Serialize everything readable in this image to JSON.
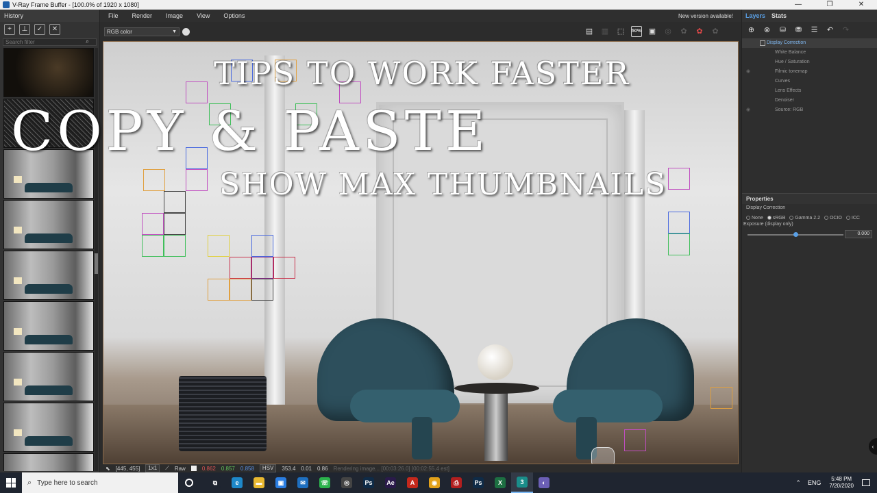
{
  "window": {
    "title": "V-Ray Frame Buffer - [100.0% of 1920 x 1080]",
    "min": "—",
    "max": "❐",
    "close": "✕"
  },
  "history": {
    "title": "History",
    "search_placeholder": "Search filter",
    "thumbs": [
      "dark",
      "noise",
      "room",
      "room",
      "room",
      "room",
      "room",
      "room",
      "room"
    ]
  },
  "menu": {
    "items": [
      "File",
      "Render",
      "Image",
      "View",
      "Options"
    ],
    "notice": "New version available!"
  },
  "toolbar": {
    "channel": "RGB color",
    "zoom_badge": "50%"
  },
  "overlay": {
    "line1": "TIPS TO WORK FASTER",
    "line2": "COPY & PASTE",
    "line3": "SHOW MAX THUMBNAILS"
  },
  "status": {
    "coords": "[445, 455]",
    "ratio": "1x1",
    "raw_label": "Raw",
    "r": "0.862",
    "g": "0.857",
    "b": "0.858",
    "mode": "HSV",
    "h": "353.4",
    "s": "0.01",
    "v": "0.86",
    "progress": "Rendering image... [00:03:26.0] [00:02:55.4 est]"
  },
  "right": {
    "tab_layers": "Layers",
    "tab_stats": "Stats",
    "layers": [
      "Display Correction",
      "White Balance",
      "Hue / Saturation",
      "Filmic tonemap",
      "Curves",
      "Lens Effects",
      "Denoiser",
      "Source: RGB"
    ],
    "properties_title": "Properties",
    "properties_sub": "Display Correction",
    "radio_options": [
      "None",
      "sRGB",
      "Gamma 2.2",
      "OCIO",
      "ICC"
    ],
    "radio_selected": "sRGB",
    "exposure_label": "Exposure (display only)",
    "exposure_value": "0.000",
    "exposure_fraction": 0.5
  },
  "taskbar": {
    "search_placeholder": "Type here to search",
    "apps": [
      {
        "name": "task-view",
        "glyph": "⧉",
        "color": "#1f2530"
      },
      {
        "name": "edge",
        "glyph": "e",
        "color": "#1e88c9"
      },
      {
        "name": "explorer",
        "glyph": "▬",
        "color": "#e8b830"
      },
      {
        "name": "store",
        "glyph": "▣",
        "color": "#2a7de1"
      },
      {
        "name": "mail",
        "glyph": "✉",
        "color": "#1e6fc0"
      },
      {
        "name": "whatsapp",
        "glyph": "☏",
        "color": "#2bb24c"
      },
      {
        "name": "chrome-dark",
        "glyph": "◎",
        "color": "#444"
      },
      {
        "name": "photoshop",
        "glyph": "Ps",
        "color": "#0f2b47"
      },
      {
        "name": "after-effects",
        "glyph": "Ae",
        "color": "#2a1a4a"
      },
      {
        "name": "acrobat",
        "glyph": "A",
        "color": "#c4281c"
      },
      {
        "name": "chrome",
        "glyph": "◉",
        "color": "#e2a11a"
      },
      {
        "name": "pdf",
        "glyph": "⎙",
        "color": "#b21f1f"
      },
      {
        "name": "photoshop-2",
        "glyph": "Ps",
        "color": "#0f2b47"
      },
      {
        "name": "excel",
        "glyph": "X",
        "color": "#1d6f42"
      },
      {
        "name": "3dsmax",
        "glyph": "3",
        "color": "#1a8d8a"
      },
      {
        "name": "vray",
        "glyph": "◐",
        "color": "#6b5fb5"
      }
    ],
    "active_app": "3dsmax",
    "lang": "ENG",
    "time": "5:48 PM",
    "date": "7/20/2020"
  },
  "colors": {
    "accent": "#5aa0e6",
    "panel": "#2e2e2e"
  }
}
